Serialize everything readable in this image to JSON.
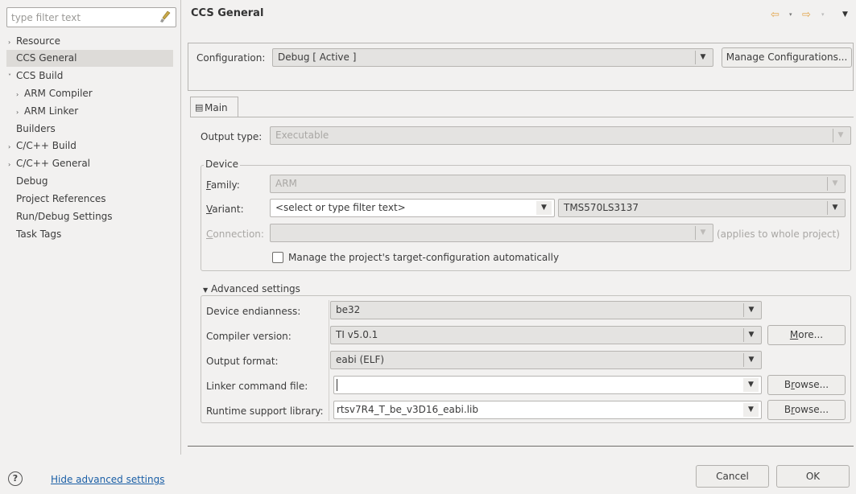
{
  "filter": {
    "placeholder": "type filter text"
  },
  "tree": [
    {
      "label": "Resource",
      "arrow": "›"
    },
    {
      "label": "CCS General",
      "arrow": "",
      "selected": true
    },
    {
      "label": "CCS Build",
      "arrow": "˅"
    },
    {
      "label": "ARM Compiler",
      "arrow": "›",
      "indent": 1
    },
    {
      "label": "ARM Linker",
      "arrow": "›",
      "indent": 1
    },
    {
      "label": "Builders",
      "arrow": ""
    },
    {
      "label": "C/C++ Build",
      "arrow": "›"
    },
    {
      "label": "C/C++ General",
      "arrow": "›"
    },
    {
      "label": "Debug",
      "arrow": ""
    },
    {
      "label": "Project References",
      "arrow": ""
    },
    {
      "label": "Run/Debug Settings",
      "arrow": ""
    },
    {
      "label": "Task Tags",
      "arrow": ""
    }
  ],
  "header": {
    "title": "CCS General",
    "icons": [
      "back-arrow-icon",
      "forward-arrow-icon",
      "view-menu-icon"
    ]
  },
  "configuration": {
    "label": "Configuration:",
    "value": "Debug [ Active ]",
    "manage_button": "Manage Configurations..."
  },
  "tabs": {
    "main": "Main"
  },
  "output_type": {
    "label": "Output type:",
    "value": "Executable"
  },
  "device": {
    "group_title": "Device",
    "family_label_mnemonic": "F",
    "family_label_rest": "amily:",
    "family_value": "ARM",
    "variant_label_mnemonic": "V",
    "variant_label_rest": "ariant:",
    "variant_filter": "<select or type filter text>",
    "variant_value": "TMS570LS3137",
    "connection_label_mnemonic": "C",
    "connection_label_rest": "onnection:",
    "connection_value": "",
    "connection_note": "(applies to whole project)",
    "manage_checkbox_label": "Manage the project's target-configuration automatically",
    "manage_checked": false
  },
  "advanced": {
    "title": "Advanced settings",
    "rows": {
      "endianness_label": "Device endianness:",
      "endianness_value": "be32",
      "compiler_label": "Compiler version:",
      "compiler_value": "TI v5.0.1",
      "more_button_mnemonic": "M",
      "more_button_rest": "ore...",
      "format_label": "Output format:",
      "format_value": "eabi (ELF)",
      "linker_label": "Linker command file:",
      "linker_value": "",
      "browse1_pre": "B",
      "browse1_mn": "r",
      "browse1_post": "owse...",
      "runtime_label": "Runtime support library:",
      "runtime_value": "rtsv7R4_T_be_v3D16_eabi.lib",
      "browse2_pre": "B",
      "browse2_mn": "r",
      "browse2_post": "owse..."
    }
  },
  "footer": {
    "help_icon": "?",
    "hide_link": "Hide advanced settings",
    "cancel": "Cancel",
    "ok": "OK"
  }
}
